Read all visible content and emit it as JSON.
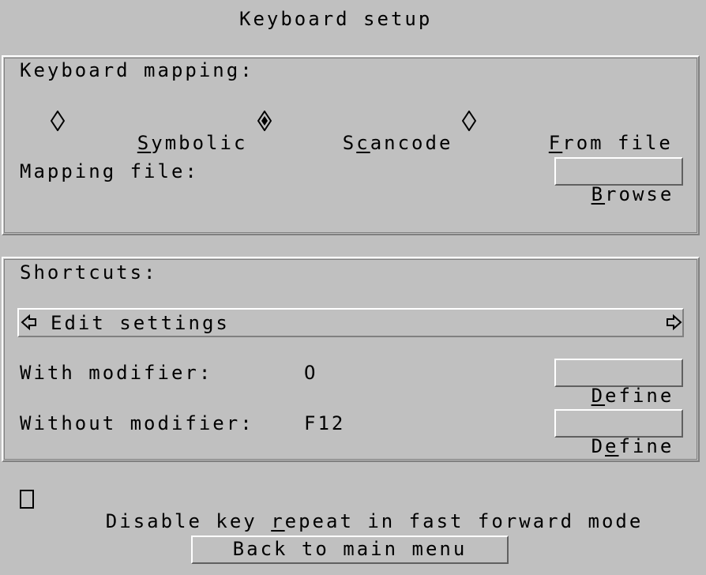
{
  "title": "Keyboard setup",
  "keyboard_mapping": {
    "label": "Keyboard mapping:",
    "options": [
      {
        "hot": "S",
        "rest": "ymbolic",
        "selected": false
      },
      {
        "pre": "S",
        "hot": "c",
        "rest": "ancode",
        "selected": true
      },
      {
        "hot": "F",
        "rest": "rom file",
        "selected": false
      }
    ],
    "file_label": "Mapping file:",
    "browse": {
      "hot": "B",
      "rest": "rowse"
    }
  },
  "shortcuts": {
    "label": "Shortcuts:",
    "selected": "Edit settings",
    "with_modifier": {
      "label": "With modifier:",
      "value": "O"
    },
    "without_modifier": {
      "label": "Without modifier:",
      "value": "F12"
    },
    "define1": {
      "hot": "D",
      "rest": "efine"
    },
    "define2": {
      "pre": "D",
      "hot": "e",
      "rest": "fine"
    }
  },
  "disable_repeat": {
    "pre": "Disable key ",
    "hot": "r",
    "rest": "epeat in fast forward mode",
    "checked": false
  },
  "back_button": "Back to main menu"
}
